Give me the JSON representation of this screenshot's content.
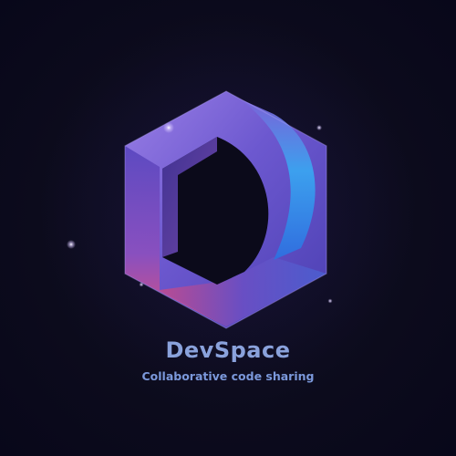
{
  "brand": {
    "name": "DevSpace",
    "tagline": "Collaborative code sharing"
  },
  "logo": {
    "icon": "hexagon-d-logo-icon",
    "letter": "D"
  },
  "colors": {
    "background": "#0b0a1a",
    "brand_text": "#8aa2dc",
    "tagline_text": "#7b98db",
    "accent_blue": "#3aa4f0",
    "accent_violet": "#7b60d6",
    "accent_pink": "#e0507e"
  }
}
